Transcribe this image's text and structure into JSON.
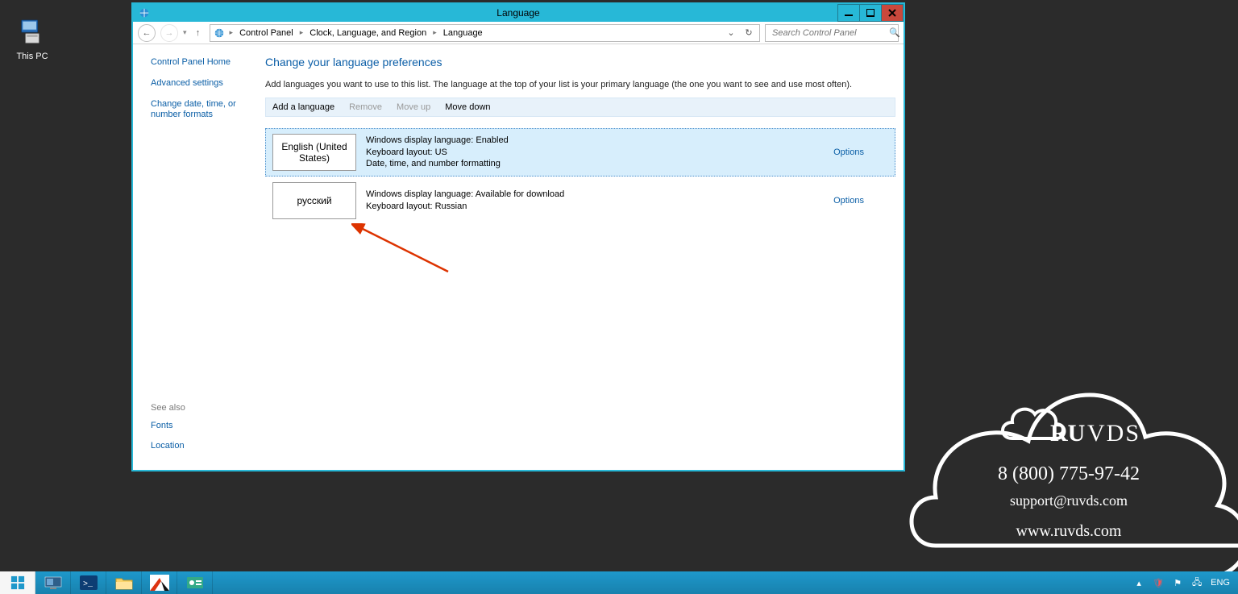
{
  "desktop": {
    "this_pc": "This PC"
  },
  "window": {
    "title": "Language",
    "breadcrumbs": {
      "b1": "Control Panel",
      "b2": "Clock, Language, and Region",
      "b3": "Language"
    },
    "search_placeholder": "Search Control Panel"
  },
  "sidebar": {
    "home": "Control Panel Home",
    "advanced": "Advanced settings",
    "datefmt": "Change date, time, or number formats"
  },
  "see_also": {
    "header": "See also",
    "fonts": "Fonts",
    "location": "Location"
  },
  "main": {
    "heading": "Change your language preferences",
    "desc": "Add languages you want to use to this list. The language at the top of your list is your primary language (the one you want to see and use most often).",
    "cmds": {
      "add": "Add a language",
      "remove": "Remove",
      "up": "Move up",
      "down": "Move down"
    },
    "langs": [
      {
        "tile": "English (United States)",
        "l1": "Windows display language: Enabled",
        "l2": "Keyboard layout: US",
        "l3": "Date, time, and number formatting",
        "options": "Options"
      },
      {
        "tile": "русский",
        "l1": "Windows display language: Available for download",
        "l2": "Keyboard layout: Russian",
        "l3": "",
        "options": "Options"
      }
    ]
  },
  "watermark": {
    "brand_prefix": "RU",
    "brand_suffix": "VDS",
    "phone": "8 (800) 775-97-42",
    "email": "support@ruvds.com",
    "site": "www.ruvds.com"
  },
  "taskbar": {
    "lang": "ENG"
  }
}
